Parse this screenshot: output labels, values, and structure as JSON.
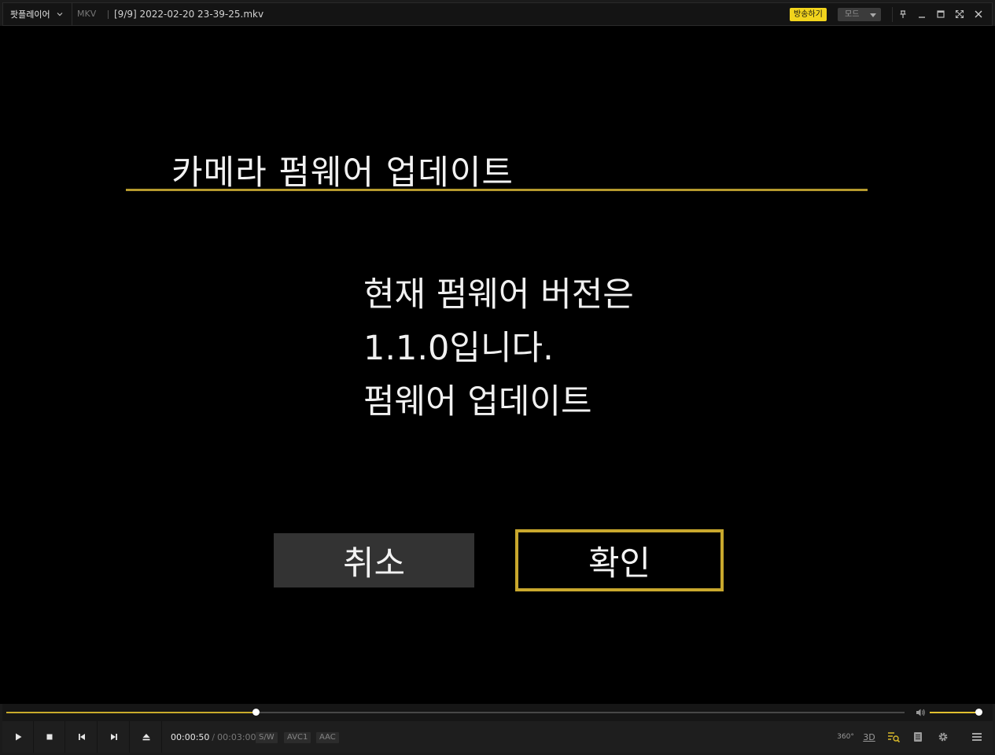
{
  "app": {
    "menu_label": "팟플레이어",
    "format": "MKV",
    "file_title": "[9/9]  2022-02-20  23-39-25.mkv",
    "broadcast_label": "방송하기",
    "mode_label": "모드"
  },
  "video": {
    "dialog_title": "카메라 펌웨어 업데이트",
    "message_lines": [
      "현재 펌웨어 버전은",
      "1.1.0입니다.",
      "펌웨어 업데이트"
    ],
    "cancel_label": "취소",
    "ok_label": "확인"
  },
  "playback": {
    "current_time": "00:00:50",
    "separator": "/",
    "total_time": "00:03:00",
    "progress": 0.2778,
    "volume": 0.97,
    "tags": [
      "S/W",
      "AVC1",
      "AAC"
    ]
  },
  "toolbar_right": {
    "vr_label": "360°",
    "three_d_label": "3D"
  },
  "colors": {
    "accent_yellow": "#f2d41d",
    "progress_gold": "#c8aa2b",
    "dialog_gold": "#c9a82d",
    "cancel_gray": "#333333"
  },
  "icons": [
    "chevron-down-icon",
    "pin-icon",
    "minimize-icon",
    "maximize-icon",
    "fullscreen-icon",
    "close-icon",
    "play-icon",
    "stop-icon",
    "previous-icon",
    "next-icon",
    "eject-icon",
    "volume-icon",
    "playlist-search-icon",
    "chapter-icon",
    "settings-icon",
    "menu-icon"
  ]
}
